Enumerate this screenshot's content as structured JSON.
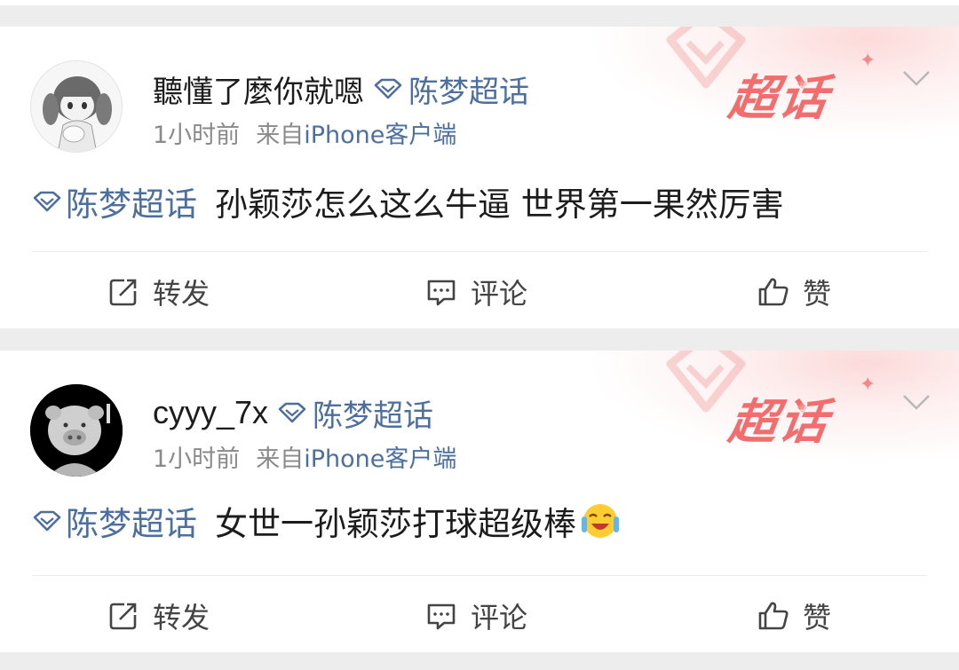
{
  "colors": {
    "topic_blue": "#4d6fa0",
    "watermark_red": "#f26d6d",
    "meta_gray": "#8a8a8a",
    "feed_bg": "#ededed"
  },
  "posts": [
    {
      "username": "聽懂了麼你就嗯",
      "topic": "陈梦超话",
      "time": "1小时前",
      "source_prefix": "来自",
      "source": "iPhone客户端",
      "content": "孙颖莎怎么这么牛逼 世界第一果然厉害",
      "badge_watermark": "超话",
      "avatar_icon": "anime-girl-avatar",
      "actions": {
        "forward": "转发",
        "comment": "评论",
        "like": "赞"
      }
    },
    {
      "username": "cyyy_7x",
      "topic": "陈梦超话",
      "time": "1小时前",
      "source_prefix": "来自",
      "source": "iPhone客户端",
      "content": "女世一孙颖莎打球超级棒",
      "emoji": "crying-laughing-emoji",
      "badge_watermark": "超话",
      "avatar_icon": "cartoon-pig-avatar",
      "actions": {
        "forward": "转发",
        "comment": "评论",
        "like": "赞"
      }
    }
  ]
}
